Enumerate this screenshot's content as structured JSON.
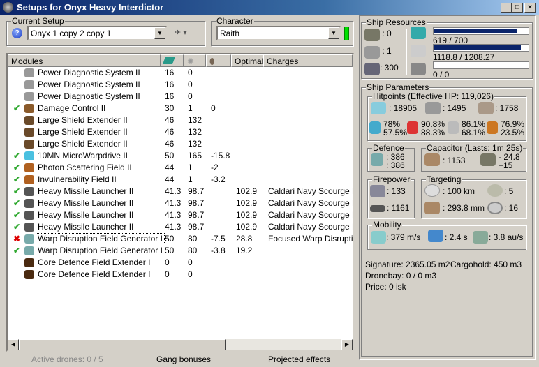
{
  "window": {
    "title": "Setups for Onyx Heavy Interdictor",
    "buttons": [
      "_",
      "□",
      "×"
    ]
  },
  "current_setup": {
    "label": "Current Setup",
    "value": "Onyx 1 copy 2 copy 1"
  },
  "character": {
    "label": "Character",
    "value": "Raith",
    "status_color": "#00e000"
  },
  "modules": {
    "headers": [
      "Modules",
      "cpu-icon",
      "powergrid-icon",
      "capacitor-icon",
      "Optimal",
      "Charges"
    ],
    "rows": [
      {
        "state": "",
        "name": "Power Diagnostic System II",
        "cpu": "16",
        "pg": "0",
        "cap": "",
        "optimal": "",
        "charges": "",
        "color": "#999"
      },
      {
        "state": "",
        "name": "Power Diagnostic System II",
        "cpu": "16",
        "pg": "0",
        "cap": "",
        "optimal": "",
        "charges": "",
        "color": "#999"
      },
      {
        "state": "",
        "name": "Power Diagnostic System II",
        "cpu": "16",
        "pg": "0",
        "cap": "",
        "optimal": "",
        "charges": "",
        "color": "#999"
      },
      {
        "state": "active",
        "name": "Damage Control II",
        "cpu": "30",
        "pg": "1",
        "cap": "0",
        "optimal": "",
        "charges": "",
        "color": "#8a5a2a"
      },
      {
        "state": "",
        "name": "Large Shield Extender II",
        "cpu": "46",
        "pg": "132",
        "cap": "",
        "optimal": "",
        "charges": "",
        "color": "#6a4a2a"
      },
      {
        "state": "",
        "name": "Large Shield Extender II",
        "cpu": "46",
        "pg": "132",
        "cap": "",
        "optimal": "",
        "charges": "",
        "color": "#6a4a2a"
      },
      {
        "state": "",
        "name": "Large Shield Extender II",
        "cpu": "46",
        "pg": "132",
        "cap": "",
        "optimal": "",
        "charges": "",
        "color": "#6a4a2a"
      },
      {
        "state": "active",
        "name": "10MN MicroWarpdrive II",
        "cpu": "50",
        "pg": "165",
        "cap": "-15.8",
        "optimal": "",
        "charges": "",
        "color": "#4ac0e0"
      },
      {
        "state": "active",
        "name": "Photon Scattering Field II",
        "cpu": "44",
        "pg": "1",
        "cap": "-2",
        "optimal": "",
        "charges": "",
        "color": "#b06020"
      },
      {
        "state": "active",
        "name": "Invulnerability Field II",
        "cpu": "44",
        "pg": "1",
        "cap": "-3.2",
        "optimal": "",
        "charges": "",
        "color": "#b06020"
      },
      {
        "state": "active",
        "name": "Heavy Missile Launcher II",
        "cpu": "41.3",
        "pg": "98.7",
        "cap": "",
        "optimal": "102.9",
        "charges": "Caldari Navy Scourge Hea",
        "color": "#555"
      },
      {
        "state": "active",
        "name": "Heavy Missile Launcher II",
        "cpu": "41.3",
        "pg": "98.7",
        "cap": "",
        "optimal": "102.9",
        "charges": "Caldari Navy Scourge Hea",
        "color": "#555"
      },
      {
        "state": "active",
        "name": "Heavy Missile Launcher II",
        "cpu": "41.3",
        "pg": "98.7",
        "cap": "",
        "optimal": "102.9",
        "charges": "Caldari Navy Scourge Hea",
        "color": "#555"
      },
      {
        "state": "active",
        "name": "Heavy Missile Launcher II",
        "cpu": "41.3",
        "pg": "98.7",
        "cap": "",
        "optimal": "102.9",
        "charges": "Caldari Navy Scourge Hea",
        "color": "#555"
      },
      {
        "state": "offline",
        "name": "Warp Disruption Field Generator I",
        "cpu": "50",
        "pg": "80",
        "cap": "-7.5",
        "optimal": "28.8",
        "charges": "Focused Warp Disruption",
        "color": "#7aa"
      },
      {
        "state": "active",
        "name": "Warp Disruption Field Generator I",
        "cpu": "50",
        "pg": "80",
        "cap": "-3.8",
        "optimal": "19.2",
        "charges": "",
        "color": "#7aa"
      },
      {
        "state": "",
        "name": "Core Defence Field Extender I",
        "cpu": "0",
        "pg": "0",
        "cap": "",
        "optimal": "",
        "charges": "",
        "color": "#4a2a10"
      },
      {
        "state": "",
        "name": "Core Defence Field Extender I",
        "cpu": "0",
        "pg": "0",
        "cap": "",
        "optimal": "",
        "charges": "",
        "color": "#4a2a10"
      }
    ]
  },
  "bottom": {
    "drones": "Active drones: 0 / 5",
    "gang": "Gang bonuses",
    "projected": "Projected effects"
  },
  "resources": {
    "label": "Ship Resources",
    "turrets": ": 0",
    "launchers": ": 1",
    "calibration": ": 300",
    "cpu": {
      "text": "619 / 700",
      "fraction": 0.884
    },
    "powergrid": {
      "text": "1118.8 / 1208.27",
      "fraction": 0.926
    },
    "drone_bw": {
      "text": "0 / 0",
      "fraction": 0
    }
  },
  "params": {
    "label": "Ship Parameters",
    "hp": {
      "label": "Hitpoints (Effective HP: 119,026)",
      "shield": ": 18905",
      "armor": ": 1495",
      "structure": ": 1758",
      "resists": [
        [
          "78%",
          "57.5%"
        ],
        [
          "90.8%",
          "88.3%"
        ],
        [
          "86.1%",
          "68.1%"
        ],
        [
          "76.9%",
          "23.5%"
        ]
      ]
    },
    "defence": {
      "label": "Defence",
      "a": ": 386",
      "b": ": 386"
    },
    "capacitor": {
      "label": "Capacitor (Lasts: 1m 25s)",
      "amount": ": 1153",
      "delta": "- 24.8",
      "plus": "+15"
    },
    "firepower": {
      "label": "Firepower",
      "a": ": 133",
      "b": ": 1161"
    },
    "targeting": {
      "label": "Targeting",
      "range": ": 100 km",
      "targets": ": 5",
      "scan": ": 293.8 mm",
      "sensor": ": 16"
    },
    "mobility": {
      "label": "Mobility",
      "speed": ": 379 m/s",
      "align": ": 2.4 s",
      "warp": ": 3.8 au/s"
    },
    "signature": "Signature: 2365.05 m2",
    "cargo": "Cargohold: 450 m3",
    "dronebay": "Dronebay: 0 / 0 m3",
    "price": "Price: 0 isk"
  }
}
